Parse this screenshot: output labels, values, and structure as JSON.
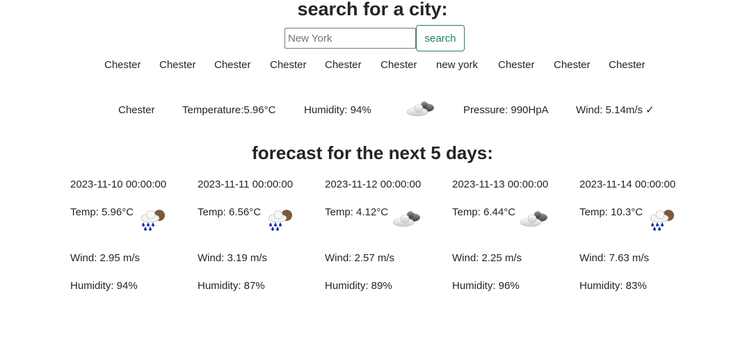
{
  "search": {
    "title": "search for a city:",
    "placeholder": "New York",
    "button_label": "search"
  },
  "history": [
    "Chester",
    "Chester",
    "Chester",
    "Chester",
    "Chester",
    "Chester",
    "new york",
    "Chester",
    "Chester",
    "Chester"
  ],
  "current": {
    "city": "Chester",
    "temperature": "Temperature:5.96°C",
    "humidity": "Humidity: 94%",
    "icon": "cloud-icon",
    "pressure": "Pressure: 990HpA",
    "wind": "Wind: 5.14m/s ✓"
  },
  "forecast": {
    "title": "forecast for the next 5 days:",
    "days": [
      {
        "date": "2023-11-10 00:00:00",
        "temp": "Temp: 5.96°C",
        "icon": "rain-sun-icon",
        "wind": "Wind: 2.95 m/s",
        "humidity": "Humidity: 94%"
      },
      {
        "date": "2023-11-11 00:00:00",
        "temp": "Temp: 6.56°C",
        "icon": "rain-sun-icon",
        "wind": "Wind: 3.19 m/s",
        "humidity": "Humidity: 87%"
      },
      {
        "date": "2023-11-12 00:00:00",
        "temp": "Temp: 4.12°C",
        "icon": "cloud-icon",
        "wind": "Wind: 2.57 m/s",
        "humidity": "Humidity: 89%"
      },
      {
        "date": "2023-11-13 00:00:00",
        "temp": "Temp: 6.44°C",
        "icon": "cloud-icon",
        "wind": "Wind: 2.25 m/s",
        "humidity": "Humidity: 96%"
      },
      {
        "date": "2023-11-14 00:00:00",
        "temp": "Temp: 10.3°C",
        "icon": "rain-sun-icon",
        "wind": "Wind: 7.63 m/s",
        "humidity": "Humidity: 83%"
      }
    ]
  }
}
